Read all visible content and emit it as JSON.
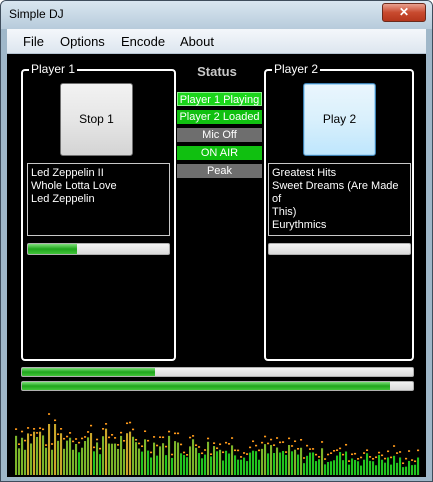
{
  "window": {
    "title": "Simple DJ",
    "close_glyph": "✕"
  },
  "menu": [
    "File",
    "Options",
    "Encode",
    "About"
  ],
  "player1": {
    "label": "Player 1",
    "button": "Stop 1",
    "tracks": [
      "Led Zeppelin II",
      "Whole Lotta Love",
      "Led Zeppelin"
    ],
    "progress_fraction": 0.35
  },
  "player2": {
    "label": "Player 2",
    "button": "Play 2",
    "tracks": [
      "Greatest Hits",
      "Sweet Dreams (Are Made of",
      "This)",
      "Eurythmics"
    ],
    "progress_fraction": 0.0
  },
  "status": {
    "title": "Status",
    "items": [
      {
        "label": "Player 1 Playing",
        "style": "green"
      },
      {
        "label": "Player 2 Loaded",
        "style": "green-dark"
      },
      {
        "label": "Mic Off",
        "style": "gray"
      },
      {
        "label": "ON AIR",
        "style": "green-dark"
      },
      {
        "label": "Peak",
        "style": "gray"
      }
    ]
  },
  "level_meters": [
    0.34,
    0.94
  ],
  "colors": {
    "meter_green": "#22c41f",
    "peak_orange": "#ff9a1a",
    "status_green": "#1bd61b",
    "status_gray": "#6e6e6e"
  }
}
